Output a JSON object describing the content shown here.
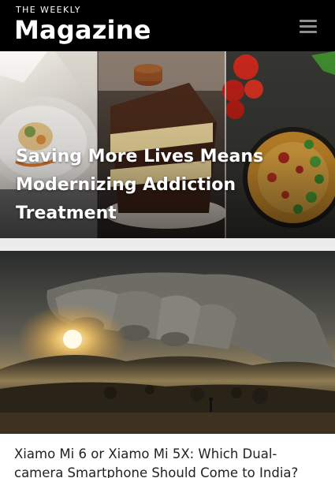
{
  "header": {
    "brand_sup": "THE WEEKLY",
    "brand_main": "Magazine",
    "menu_icon": "hamburger-menu-icon"
  },
  "articles": [
    {
      "title": "Saving More Lives Means Modernizing Addiction Treatment",
      "image": "food-plates-image"
    },
    {
      "title": "Xiamo Mi 6 or Xiamo Mi 5X: Which Dual-camera Smartphone Should Come to India?",
      "image": "hand-over-misty-valley-image"
    }
  ],
  "colors": {
    "header_bg": "#000000",
    "page_bg": "#ececec",
    "title_on_image": "#ffffff",
    "body_title": "#222222"
  }
}
